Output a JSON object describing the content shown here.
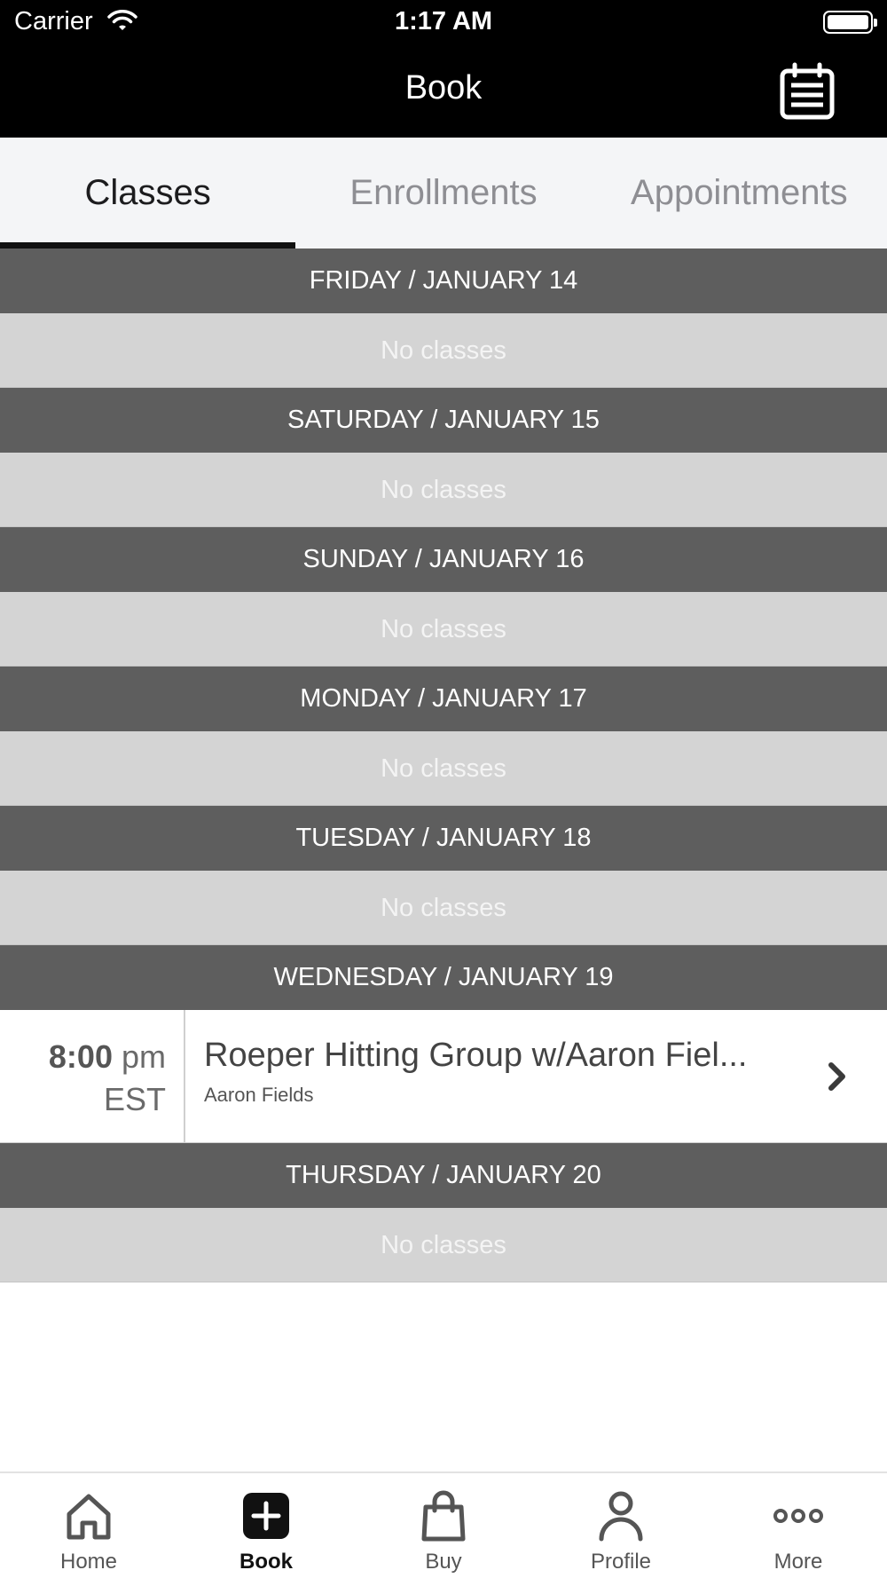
{
  "status_bar": {
    "carrier": "Carrier",
    "time": "1:17 AM"
  },
  "header": {
    "title": "Book",
    "calendar_icon": "calendar-list-icon"
  },
  "tabs": [
    {
      "label": "Classes",
      "active": true
    },
    {
      "label": "Enrollments",
      "active": false
    },
    {
      "label": "Appointments",
      "active": false
    }
  ],
  "days": [
    {
      "header": "FRIDAY / JANUARY 14",
      "empty_text": "No classes"
    },
    {
      "header": "SATURDAY / JANUARY 15",
      "empty_text": "No classes"
    },
    {
      "header": "SUNDAY / JANUARY 16",
      "empty_text": "No classes"
    },
    {
      "header": "MONDAY / JANUARY 17",
      "empty_text": "No classes"
    },
    {
      "header": "TUESDAY / JANUARY 18",
      "empty_text": "No classes"
    },
    {
      "header": "WEDNESDAY / JANUARY 19",
      "class": {
        "time": "8:00",
        "ampm": "pm",
        "timezone": "EST",
        "name": "Roeper Hitting Group w/Aaron Fiel...",
        "instructor": "Aaron Fields"
      }
    },
    {
      "header": "THURSDAY / JANUARY 20",
      "empty_text": "No classes"
    }
  ],
  "tab_bar": [
    {
      "label": "Home",
      "icon": "home-icon",
      "active": false
    },
    {
      "label": "Book",
      "icon": "plus-square-icon",
      "active": true
    },
    {
      "label": "Buy",
      "icon": "shopping-bag-icon",
      "active": false
    },
    {
      "label": "Profile",
      "icon": "person-icon",
      "active": false
    },
    {
      "label": "More",
      "icon": "more-dots-icon",
      "active": false
    }
  ],
  "colors": {
    "bar_bg": "#000000",
    "day_header_bg": "#5e5e5e",
    "empty_row_bg": "#d4d4d4",
    "tabs_bg": "#f4f5f7"
  }
}
